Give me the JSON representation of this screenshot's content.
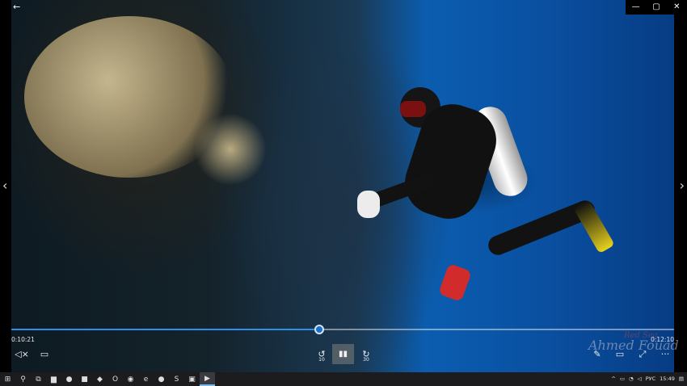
{
  "window": {
    "back_glyph": "←",
    "minimize_glyph": "—",
    "maximize_glyph": "▢",
    "close_glyph": "✕"
  },
  "nav": {
    "prev_glyph": "‹",
    "next_glyph": "›"
  },
  "watermark": {
    "text": "Ahmed Fouad",
    "sub": "Red Sea"
  },
  "player": {
    "elapsed": "0:10:21",
    "total": "0:12:10",
    "progress_fraction": 0.465,
    "rewind_seconds": "10",
    "forward_seconds": "30",
    "mute_glyph": "◁×",
    "subtitles_glyph": "▭",
    "rewind_glyph": "↺",
    "pause_glyph": "▮▮",
    "forward_glyph": "↻",
    "edit_glyph": "✎",
    "cast_glyph": "▭",
    "expand_glyph": "⤢",
    "more_glyph": "···"
  },
  "taskbar": {
    "icons": [
      {
        "name": "start-icon",
        "glyph": "⊞"
      },
      {
        "name": "search-icon",
        "glyph": "⚲"
      },
      {
        "name": "task-view-icon",
        "glyph": "⧉"
      },
      {
        "name": "file-explorer-icon",
        "glyph": "▆"
      },
      {
        "name": "firefox-icon",
        "glyph": "●"
      },
      {
        "name": "app-icon",
        "glyph": "■"
      },
      {
        "name": "app-icon-2",
        "glyph": "◆"
      },
      {
        "name": "opera-icon",
        "glyph": "O"
      },
      {
        "name": "chrome-icon",
        "glyph": "◉"
      },
      {
        "name": "edge-icon",
        "glyph": "e"
      },
      {
        "name": "app-icon-3",
        "glyph": "●"
      },
      {
        "name": "skype-icon",
        "glyph": "S"
      },
      {
        "name": "app-icon-4",
        "glyph": "▣"
      },
      {
        "name": "movies-tv-icon",
        "glyph": "▶"
      }
    ],
    "tray": {
      "chevron": "^",
      "keyboard_layout": "РУС",
      "clock": "15:49"
    }
  },
  "colors": {
    "progress_accent": "#2f8fe6",
    "taskbar_bg": "#1c1c1f"
  }
}
